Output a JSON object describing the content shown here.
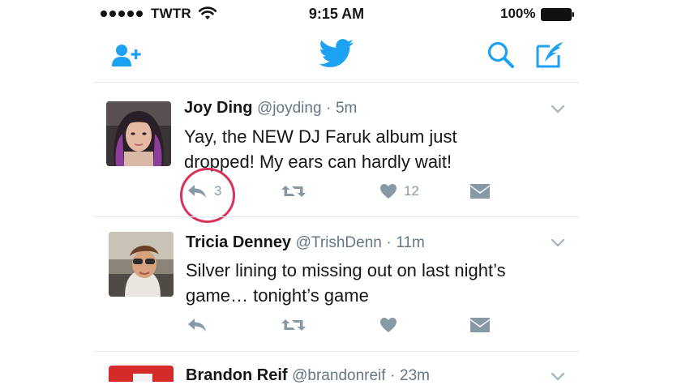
{
  "status_bar": {
    "carrier": "TWTR",
    "time": "9:15 AM",
    "battery_percent": "100%",
    "signal_dots": 5
  },
  "nav": {
    "icons": [
      "add-user-icon",
      "twitter-bird-logo",
      "search-icon",
      "compose-tweet-icon"
    ],
    "accent_color": "#1da1f2"
  },
  "tweets": [
    {
      "name": "Joy Ding",
      "handle": "@joyding",
      "separator": "·",
      "time": "5m",
      "text": "Yay, the NEW DJ Faruk album just\ndropped! My ears can hardly wait!",
      "reply_count": "3",
      "retweet_count": "",
      "like_count": "12"
    },
    {
      "name": "Tricia Denney",
      "handle": "@TrishDenn",
      "separator": "·",
      "time": "11m",
      "text": "Silver lining to missing out on last night’s\ngame… tonight’s game",
      "reply_count": "",
      "retweet_count": "",
      "like_count": ""
    },
    {
      "name": "Brandon Reif",
      "handle": "@brandonreif",
      "separator": "·",
      "time": "23m"
    }
  ],
  "colors": {
    "action_gray": "#8899a6",
    "highlight_ring": "#d8335b",
    "divider": "#e1e8ed"
  }
}
